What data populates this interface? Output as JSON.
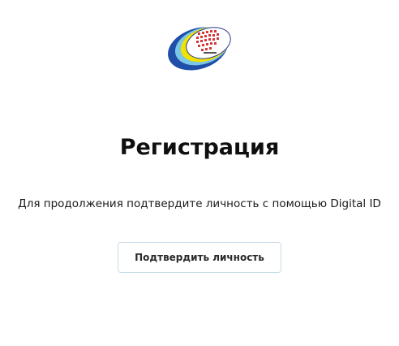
{
  "header": {
    "logo_icon": "institution-logo-icon"
  },
  "main": {
    "title": "Регистрация",
    "subtitle": "Для продолжения подтвердите личность с помощью Digital ID",
    "verify_button_label": "Подтвердить личность"
  },
  "colors": {
    "logo_blue": "#1f4fa8",
    "logo_yellow": "#f2e200",
    "logo_red": "#d4373c",
    "button_border": "#c9dde8",
    "text": "#111111"
  }
}
